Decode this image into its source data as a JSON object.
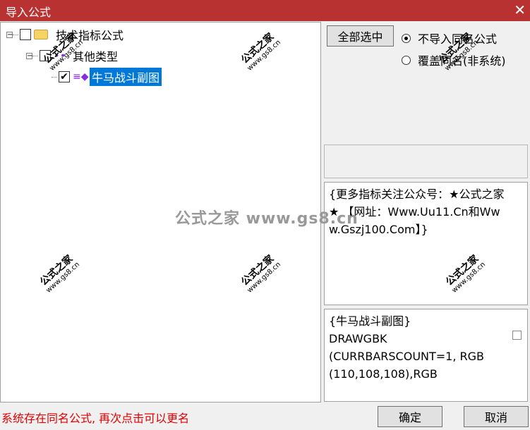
{
  "window": {
    "title": "导入公式",
    "close_icon": "✕"
  },
  "tree": {
    "root": {
      "expander": "−",
      "label": "技术指标公式",
      "checked": false
    },
    "group": {
      "expander": "−",
      "label": "其他类型",
      "checked": false
    },
    "item": {
      "label": "牛马战斗副图",
      "checked": true,
      "check_mark": "✔"
    }
  },
  "actions": {
    "select_all": "全部选中",
    "ok": "确定",
    "cancel": "取消"
  },
  "import_mode": {
    "options": [
      "不导入同名公式",
      "覆盖同名(非系统)"
    ],
    "selected": 0
  },
  "info_text": "{更多指标关注公众号：★公式之家★ 【网址：Www.Uu11.Cn和Www.Gszj100.Com】}",
  "preview_text": "{牛马战斗副图}\nDRAWGBK\n(CURRBARSCOUNT=1, RGB\n(110,108,108),RGB",
  "status_message": "系统存在同名公式, 再次点击可以更名",
  "watermark": {
    "big": "公式之家 www.gs8.cn",
    "small_line1": "公式之家",
    "small_line2": "www.gs8.cn"
  },
  "colors": {
    "titlebar": "#b83232",
    "selection": "#0078d7",
    "status": "#e00000"
  }
}
